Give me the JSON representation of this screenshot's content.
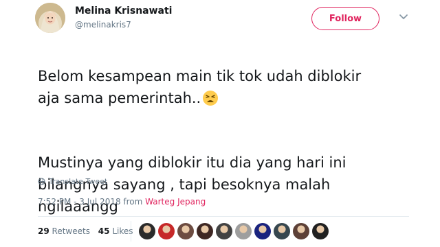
{
  "author": {
    "name": "Melina Krisnawati",
    "handle": "@melinakris7",
    "avatar_icon": "profile-photo-hijab",
    "follow_label": "Follow",
    "accent_color": "#e0245e"
  },
  "tweet": {
    "paragraph1": "Belom kesampean main tik tok udah diblokir\naja sama pemerintah..",
    "paragraph1_emoji": "tired-face-emoji",
    "paragraph2": "Mustinya yang diblokir itu dia yang hari ini\nbilangnya sayang , tapi besoknya malah\nngilaaangg",
    "translate_label": "Translate Tweet",
    "timestamp": "7:52 PM - 3 Jul 2018 from",
    "source": "Warteg Jepang"
  },
  "stats": {
    "retweets_count": "29",
    "retweets_label": "Retweets",
    "likes_count": "45",
    "likes_label": "Likes",
    "likers": [
      {
        "name": "liker-avatar-1",
        "color": "#2b2b2b"
      },
      {
        "name": "liker-avatar-2",
        "color": "#c62828"
      },
      {
        "name": "liker-avatar-3",
        "color": "#6d4c41"
      },
      {
        "name": "liker-avatar-4",
        "color": "#3e2723"
      },
      {
        "name": "liker-avatar-5",
        "color": "#424242"
      },
      {
        "name": "liker-avatar-6",
        "color": "#9e9e9e"
      },
      {
        "name": "liker-avatar-7",
        "color": "#1a237e"
      },
      {
        "name": "liker-avatar-8",
        "color": "#37474f"
      },
      {
        "name": "liker-avatar-9",
        "color": "#5d4037"
      },
      {
        "name": "liker-avatar-10",
        "color": "#212121"
      }
    ]
  }
}
